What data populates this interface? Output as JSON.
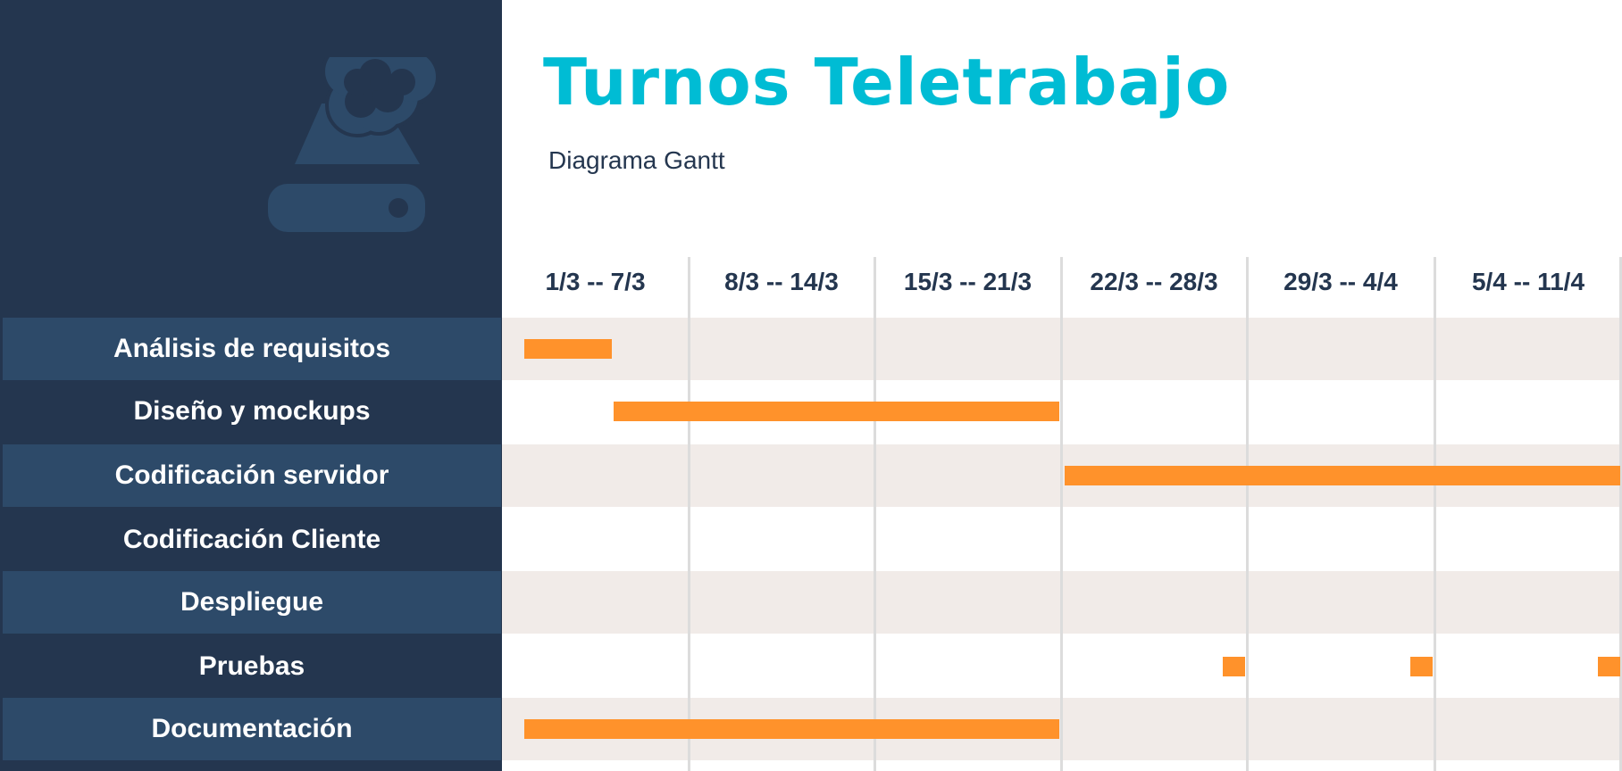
{
  "header": {
    "title": "Turnos Teletrabajo",
    "subtitle": "Diagrama Gantt"
  },
  "logo": {
    "icon": "cloud-storage-icon"
  },
  "weeks": [
    "1/3 -- 7/3",
    "8/3 -- 14/3",
    "15/3 -- 21/3",
    "22/3 -- 28/3",
    "29/3 -- 4/4",
    "5/4 -- 11/4"
  ],
  "tasks": [
    {
      "name": "Análisis de requisitos",
      "segments": [
        [
          0.12,
          0.6
        ]
      ]
    },
    {
      "name": "Diseño y mockups",
      "segments": [
        [
          0.6,
          3.0
        ]
      ]
    },
    {
      "name": "Codificación servidor",
      "segments": [
        [
          3.02,
          6.0
        ]
      ]
    },
    {
      "name": "Codificación Cliente",
      "segments": []
    },
    {
      "name": "Despliegue",
      "segments": []
    },
    {
      "name": "Pruebas",
      "segments": [
        [
          3.87,
          4.0
        ],
        [
          4.87,
          5.0
        ],
        [
          5.87,
          6.0
        ]
      ]
    },
    {
      "name": "Documentación",
      "segments": [
        [
          0.12,
          3.0
        ]
      ]
    }
  ],
  "colors": {
    "sidebar": "#24364f",
    "label_band": "#2d4a69",
    "accent_title": "#00bcd4",
    "bar": "#ff922b",
    "stripe": "#f1ebe8"
  }
}
